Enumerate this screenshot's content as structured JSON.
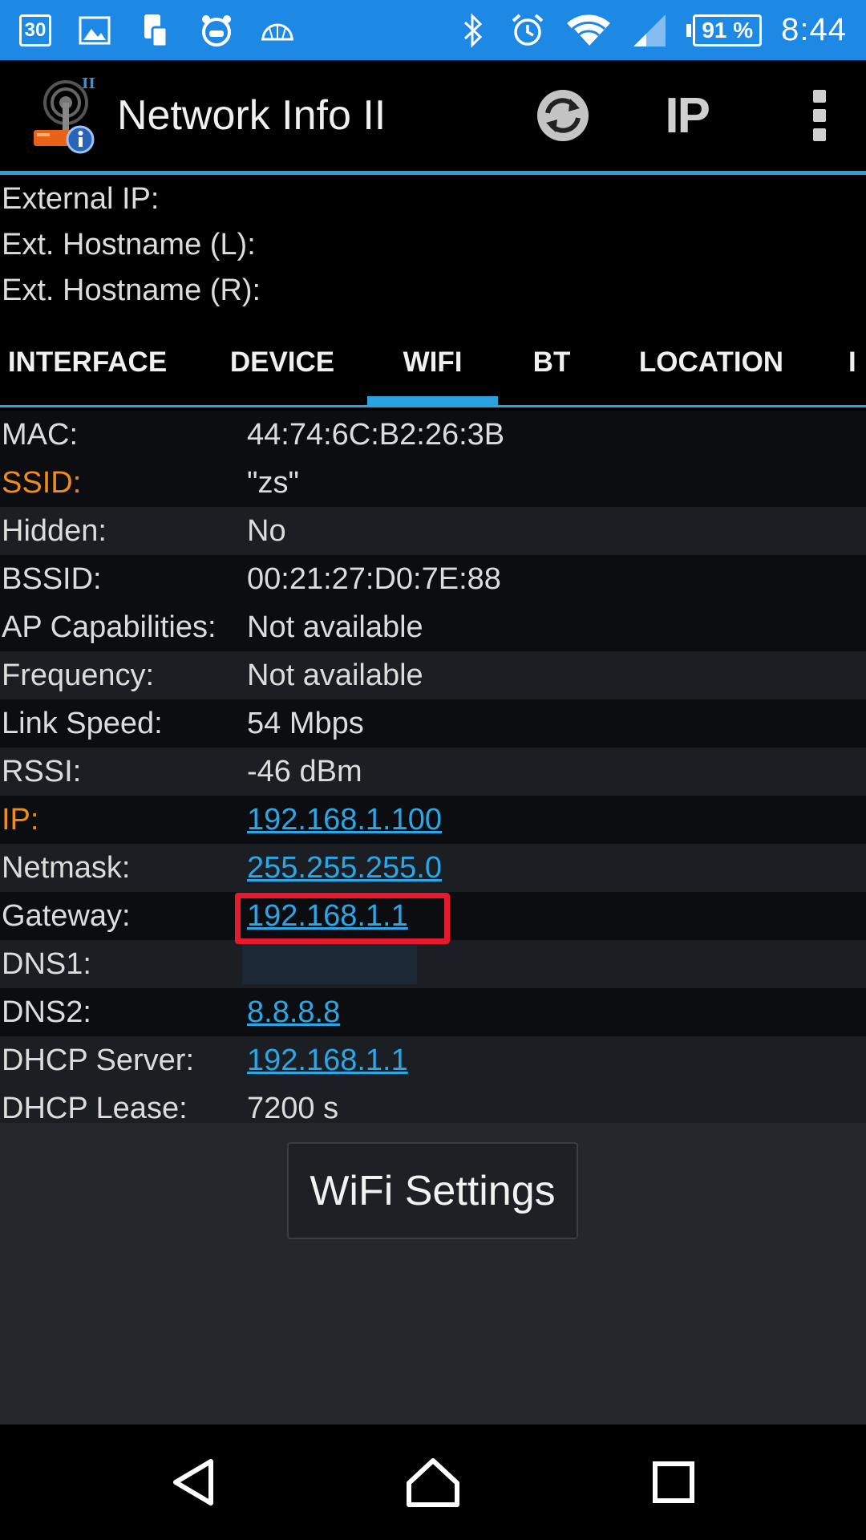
{
  "status_bar": {
    "calendar_day": "30",
    "battery": "91 %",
    "time": "8:44",
    "icons": [
      "calendar-icon",
      "image-icon",
      "phone-transfer-icon",
      "alarm-face-icon",
      "dome-icon",
      "bluetooth-icon",
      "alarm-icon",
      "wifi-icon",
      "signal-icon",
      "battery-icon"
    ]
  },
  "app_bar": {
    "title": "Network Info II",
    "ip_button": "IP"
  },
  "external": {
    "external_ip_label": "External IP:",
    "hostname_l_label": "Ext. Hostname (L):",
    "hostname_r_label": "Ext. Hostname (R):"
  },
  "tabs": [
    {
      "label": "INTERFACE"
    },
    {
      "label": "DEVICE"
    },
    {
      "label": "WIFI"
    },
    {
      "label": "BT"
    },
    {
      "label": "LOCATION"
    },
    {
      "label": "I"
    }
  ],
  "active_tab": "WIFI",
  "wifi": {
    "mac_label": "MAC:",
    "mac": "44:74:6C:B2:26:3B",
    "ssid_label": "SSID:",
    "ssid": "\"zs\"",
    "hidden_label": "Hidden:",
    "hidden": "No",
    "bssid_label": "BSSID:",
    "bssid": "00:21:27:D0:7E:88",
    "ap_cap_label": "AP Capabilities:",
    "ap_cap": "Not available",
    "frequency_label": "Frequency:",
    "frequency": "Not available",
    "link_speed_label": "Link Speed:",
    "link_speed": "54 Mbps",
    "rssi_label": "RSSI:",
    "rssi": "-46 dBm",
    "ip_label": "IP:",
    "ip": "192.168.1.100",
    "netmask_label": "Netmask:",
    "netmask": "255.255.255.0",
    "gateway_label": "Gateway:",
    "gateway": "192.168.1.1",
    "dns1_label": "DNS1:",
    "dns2_label": "DNS2:",
    "dns2": "8.8.8.8",
    "dhcp_server_label": "DHCP Server:",
    "dhcp_server": "192.168.1.1",
    "dhcp_lease_label": "DHCP Lease:",
    "dhcp_lease": "7200 s"
  },
  "wifi_settings_button": "WiFi Settings",
  "colors": {
    "status_bar": "#1e88e5",
    "accent_blue": "#29a3e0",
    "label_orange": "#f08c1a",
    "highlight_red": "#e8192c"
  }
}
